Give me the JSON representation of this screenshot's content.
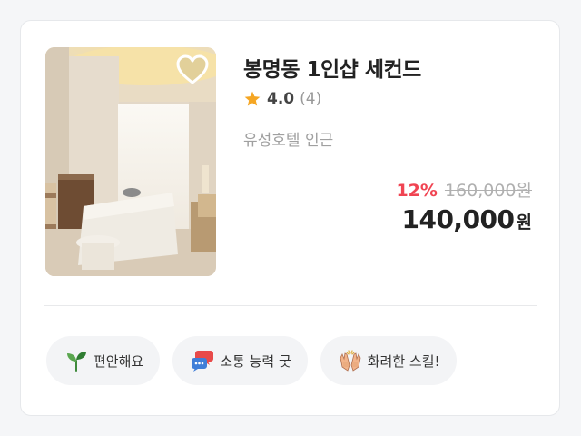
{
  "listing": {
    "title": "봉명동 1인샵 세컨드",
    "rating": "4.0",
    "review_count": "(4)",
    "location": "유성호텔 인근",
    "discount": "12%",
    "original_price": "160,000원",
    "final_price": "140,000",
    "currency": "원",
    "favorited": false
  },
  "tags": [
    {
      "label": "편안해요",
      "icon": "sprout-icon"
    },
    {
      "label": "소통 능력 굿",
      "icon": "speech-bubbles-icon"
    },
    {
      "label": "화려한 스킬!",
      "icon": "raised-hands-icon"
    }
  ],
  "colors": {
    "discount": "#f04452",
    "star": "#f5a623",
    "tag_background": "#f3f4f6"
  }
}
